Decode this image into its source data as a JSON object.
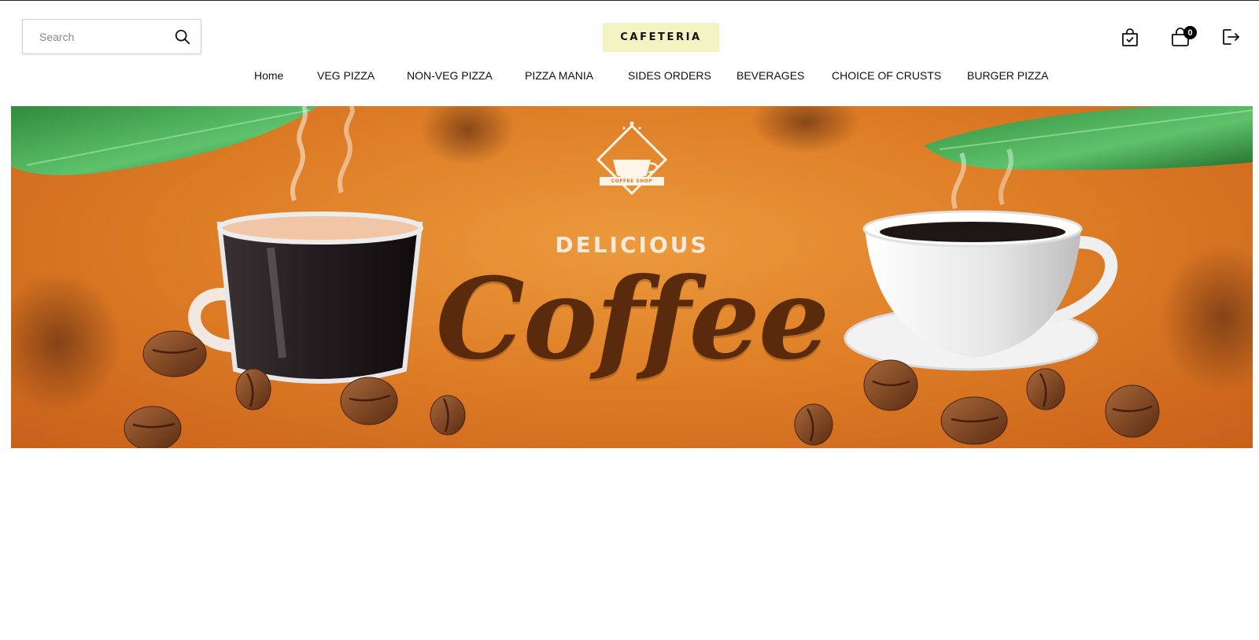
{
  "search": {
    "placeholder": "Search"
  },
  "brand": {
    "name": "CAFETERIA"
  },
  "header_icons": [
    {
      "name": "orders-bag-icon"
    },
    {
      "name": "cart-icon",
      "count": "0"
    },
    {
      "name": "logout-icon"
    }
  ],
  "nav": {
    "items": [
      {
        "label": "Home"
      },
      {
        "label": "VEG PIZZA"
      },
      {
        "label": "NON-VEG PIZZA"
      },
      {
        "label": "PIZZA MANIA"
      },
      {
        "label": "SIDES ORDERS"
      },
      {
        "label": "BEVERAGES"
      },
      {
        "label": "CHOICE OF CRUSTS"
      },
      {
        "label": "BURGER PIZZA"
      }
    ]
  },
  "banner": {
    "subtitle": "DELICIOUS",
    "title": "Coffee",
    "logo_text": "COFFEE SHOP"
  },
  "colors": {
    "brand_bg": "#f3f3c4",
    "banner_orange": "#df7f27",
    "coffee_brown": "#5a2a0c"
  }
}
